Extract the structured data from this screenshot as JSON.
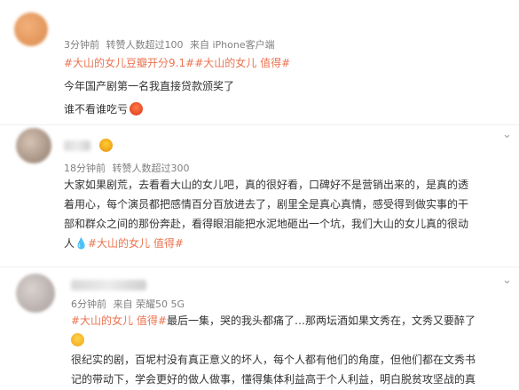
{
  "post1": {
    "time": "3分钟前",
    "reposts": "转赞人数超过100",
    "source": "来自 iPhone客户端",
    "line1": "#大山的女儿豆瓣开分9.1##大山的女儿 值得#",
    "line2": "今年国产剧第一名我直接贷款颁奖了",
    "line3": "谁不看谁吃亏"
  },
  "post2": {
    "time": "18分钟前",
    "reposts": "转赞人数超过300",
    "lines": [
      "大家如果剧荒，去看看大山的女儿吧，真的很好看，口碑好不是营销出来的，是真的透",
      "着用心，每个演员都把感情百分百放进去了，剧里全是真心真情，感受得到做实事的干",
      "部和群众之间的那份奔赴，看得眼泪能把水泥地砸出一个坑，我们大山的女儿真的很动"
    ],
    "last_prefix": "人",
    "tag": "#大山的女儿 值得#"
  },
  "post3": {
    "time": "6分钟前",
    "device": "来自 荣耀50 5G",
    "tag": "#大山的女儿 值得#",
    "line1_rest": "最后一集，哭的我头都痛了…那两坛酒如果文秀在，文秀又要醉了",
    "line3": "很纪实的剧，百坭村没有真正意义的坏人，每个人都有他们的角度，但他们都在文秀书",
    "line4": "记的带动下，学会更好的做人做事，懂得集体利益高于个人利益，明白脱贫攻坚战的真"
  },
  "icons": {
    "chevron": "chevron-down-icon"
  },
  "colors": {
    "tag": "#eb7350",
    "meta": "#808080",
    "text": "#333333"
  }
}
